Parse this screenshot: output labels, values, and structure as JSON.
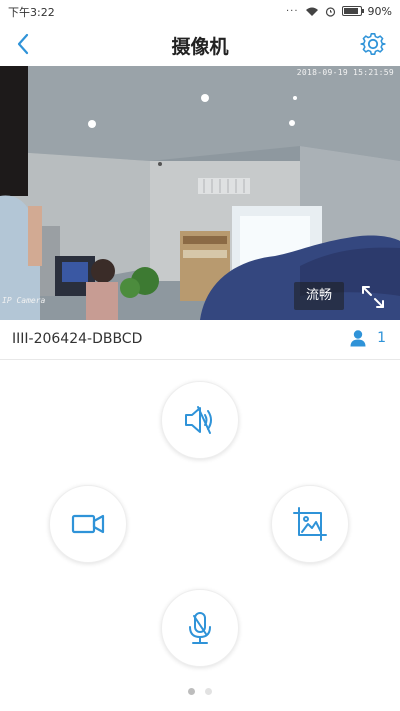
{
  "status_bar": {
    "time": "下午3:22",
    "signal_dots": "···",
    "battery_percent": "90%",
    "battery_level": 0.9
  },
  "header": {
    "title": "摄像机",
    "back_icon": "chevron-left-icon",
    "settings_icon": "gear-icon"
  },
  "video": {
    "timestamp": "2018-09-19 15:21:59",
    "camera_label": "IP Camera",
    "quality_label": "流畅",
    "fullscreen_icon": "expand-icon"
  },
  "device": {
    "id": "IIII-206424-DBBCD",
    "viewer_count": "1",
    "viewer_icon": "person-icon"
  },
  "controls": [
    {
      "name": "mute",
      "icon": "speaker-muted-icon"
    },
    {
      "name": "record",
      "icon": "video-camera-icon"
    },
    {
      "name": "snapshot",
      "icon": "image-crop-icon"
    },
    {
      "name": "microphone",
      "icon": "microphone-icon"
    }
  ],
  "pager": {
    "pages": 2,
    "active": 1
  },
  "colors": {
    "accent": "#2f93d8",
    "text": "#333333",
    "background": "#ffffff"
  }
}
